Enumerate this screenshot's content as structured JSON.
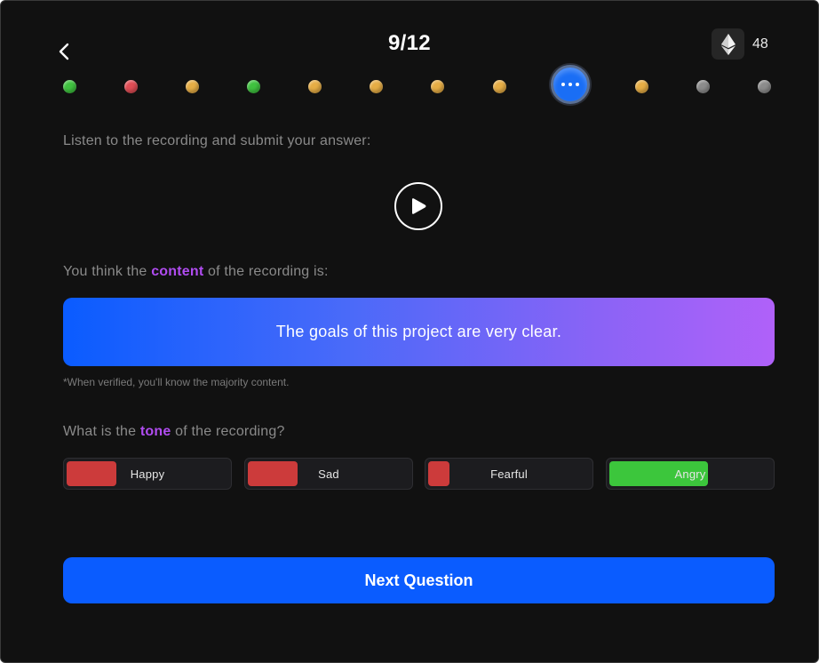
{
  "header": {
    "title": "9/12",
    "back_icon": "chevron-left-icon",
    "coin_icon": "ethereum-icon",
    "coin_count": "48"
  },
  "progress": {
    "total": 12,
    "current": 9,
    "dots": [
      {
        "status": "correct",
        "color": "#3fc23f"
      },
      {
        "status": "wrong",
        "color": "#e04d55"
      },
      {
        "status": "pending",
        "color": "#e6ad45"
      },
      {
        "status": "correct",
        "color": "#3fc23f"
      },
      {
        "status": "pending",
        "color": "#e6ad45"
      },
      {
        "status": "pending",
        "color": "#e6ad45"
      },
      {
        "status": "pending",
        "color": "#e6ad45"
      },
      {
        "status": "pending",
        "color": "#e6ad45"
      },
      {
        "status": "current",
        "color": "#1a6ef5"
      },
      {
        "status": "pending",
        "color": "#e6ad45"
      },
      {
        "status": "unanswered",
        "color": "#8c8c8c"
      },
      {
        "status": "unanswered",
        "color": "#8c8c8c"
      }
    ]
  },
  "instructions": {
    "listen": "Listen to the recording and submit your answer:",
    "play_icon": "play-icon"
  },
  "content_question": {
    "prefix": "You think the ",
    "highlight": "content",
    "suffix": " of the recording is:",
    "answer": "The goals of this project are very clear.",
    "note": "*When verified, you'll know the majority content."
  },
  "tone_question": {
    "prefix": "What is the ",
    "highlight": "tone",
    "suffix": " of the recording?",
    "options": [
      {
        "label": "Happy",
        "fill": 0.3,
        "color": "#cc3b3b"
      },
      {
        "label": "Sad",
        "fill": 0.3,
        "color": "#cc3b3b"
      },
      {
        "label": "Fearful",
        "fill": 0.13,
        "color": "#cc3b3b"
      },
      {
        "label": "Angry",
        "fill": 0.59,
        "color": "#3cc63c"
      }
    ]
  },
  "actions": {
    "next_label": "Next Question"
  },
  "colors": {
    "accent": "#0a5cff",
    "highlight": "#b04cf0",
    "background": "#111111"
  }
}
